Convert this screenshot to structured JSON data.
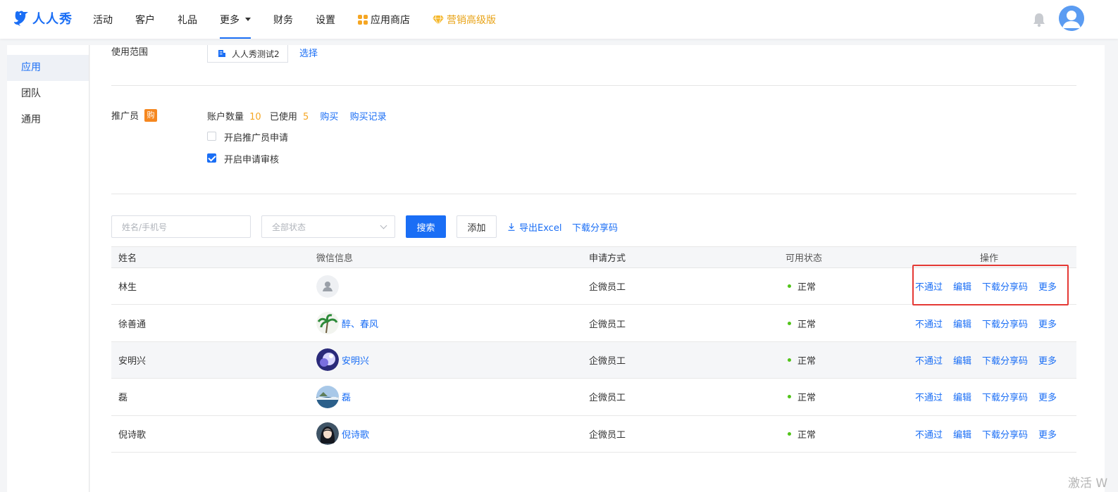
{
  "brand": {
    "name": "人人秀"
  },
  "nav": {
    "items": [
      {
        "label": "活动"
      },
      {
        "label": "客户"
      },
      {
        "label": "礼品"
      },
      {
        "label": "更多"
      },
      {
        "label": "财务"
      },
      {
        "label": "设置"
      },
      {
        "label": "应用商店"
      },
      {
        "label": "营销高级版"
      }
    ],
    "active": "更多"
  },
  "sidebar": {
    "items": [
      {
        "label": "应用"
      },
      {
        "label": "团队"
      },
      {
        "label": "通用"
      }
    ],
    "active": "应用"
  },
  "scope": {
    "label": "使用范围",
    "value": "人人秀测试2",
    "select_link": "选择"
  },
  "promoter": {
    "label": "推广员",
    "buy_badge": "购",
    "account_label": "账户数量",
    "account_count": "10",
    "used_label": "已使用",
    "used_count": "5",
    "buy_link": "购买",
    "record_link": "购买记录",
    "options": [
      {
        "label": "开启推广员申请",
        "checked": false
      },
      {
        "label": "开启申请审核",
        "checked": true
      }
    ]
  },
  "toolbar": {
    "name_placeholder": "姓名/手机号",
    "status_placeholder": "全部状态",
    "search_label": "搜索",
    "add_label": "添加",
    "export_label": "导出Excel",
    "download_qr_label": "下载分享码"
  },
  "table": {
    "headers": [
      "姓名",
      "微信信息",
      "申请方式",
      "可用状态",
      "操作"
    ],
    "rows": [
      {
        "name": "林生",
        "wechat": "",
        "avatar": "default",
        "apply": "企微员工",
        "status": "正常"
      },
      {
        "name": "徐善通",
        "wechat": "醉、春风",
        "avatar": "palm",
        "apply": "企微员工",
        "status": "正常"
      },
      {
        "name": "安明兴",
        "wechat": "安明兴",
        "avatar": "purple",
        "apply": "企微员工",
        "status": "正常"
      },
      {
        "name": "磊",
        "wechat": "磊",
        "avatar": "sea",
        "apply": "企微员工",
        "status": "正常"
      },
      {
        "name": "倪诗歌",
        "wechat": "倪诗歌",
        "avatar": "girl",
        "apply": "企微员工",
        "status": "正常"
      }
    ],
    "actions": [
      "不通过",
      "编辑",
      "下载分享码",
      "更多"
    ]
  },
  "status_color": "#52c41a",
  "accent": "#1a6ef5",
  "highlight_color": "#e53935",
  "watermark": "激活 W"
}
